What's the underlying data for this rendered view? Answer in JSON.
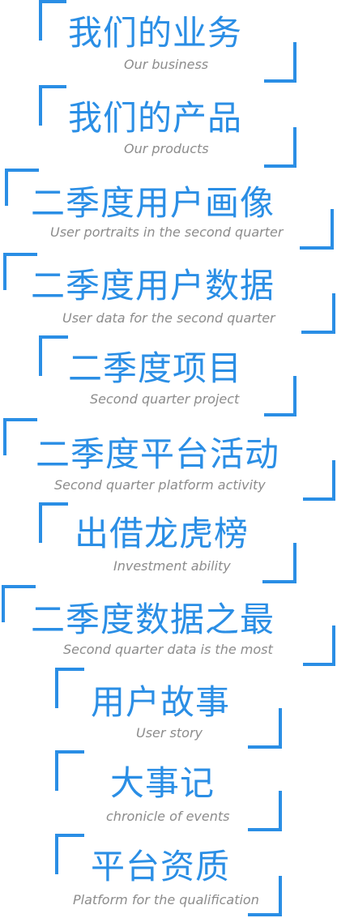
{
  "accent_color": "#2a8ee5",
  "subtitle_color": "#8c8c8c",
  "sections": [
    {
      "title": "我们的业务",
      "subtitle": "Our business"
    },
    {
      "title": "我们的产品",
      "subtitle": "Our products"
    },
    {
      "title": "二季度用户画像",
      "subtitle": "User portraits in the second quarter"
    },
    {
      "title": "二季度用户数据",
      "subtitle": "User data for the second quarter"
    },
    {
      "title": "二季度项目",
      "subtitle": "Second quarter project"
    },
    {
      "title": "二季度平台活动",
      "subtitle": "Second quarter platform activity"
    },
    {
      "title": "出借龙虎榜",
      "subtitle": "Investment ability"
    },
    {
      "title": "二季度数据之最",
      "subtitle": "Second quarter data is the most"
    },
    {
      "title": "用户故事",
      "subtitle": "User story"
    },
    {
      "title": "大事记",
      "subtitle": "chronicle of events"
    },
    {
      "title": "平台资质",
      "subtitle": "Platform for the qualification"
    }
  ]
}
